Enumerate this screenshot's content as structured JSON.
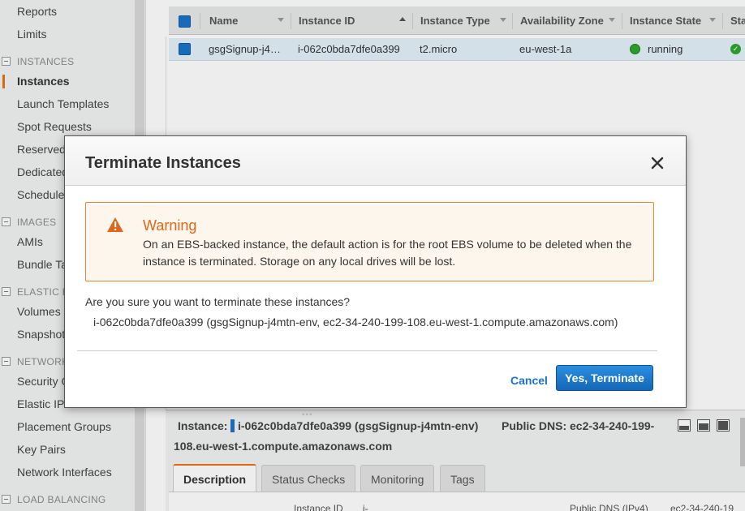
{
  "sidebar": {
    "items": [
      {
        "label": "Reports"
      },
      {
        "label": "Limits"
      },
      {
        "label": "Instances"
      },
      {
        "label": "Launch Templates"
      },
      {
        "label": "Spot Requests"
      },
      {
        "label": "Reserved"
      },
      {
        "label": "Dedicated"
      },
      {
        "label": "Schedule"
      },
      {
        "label": "AMIs"
      },
      {
        "label": "Bundle Ta"
      },
      {
        "label": "Volumes"
      },
      {
        "label": "Snapshot"
      },
      {
        "label": "Security G"
      },
      {
        "label": "Elastic IP"
      },
      {
        "label": "Placement Groups"
      },
      {
        "label": "Key Pairs"
      },
      {
        "label": "Network Interfaces"
      }
    ],
    "sections": [
      {
        "label": "INSTANCES"
      },
      {
        "label": "IMAGES"
      },
      {
        "label": "ELASTIC B"
      },
      {
        "label": "NETWORK"
      },
      {
        "label": "LOAD BALANCING"
      }
    ],
    "active_item": "Instances"
  },
  "table": {
    "columns": [
      "Name",
      "Instance ID",
      "Instance Type",
      "Availability Zone",
      "Instance State",
      "Sta"
    ],
    "rows": [
      {
        "name": "gsgSignup-j4…",
        "instance_id": "i-062c0bda7dfe0a399",
        "instance_type": "t2.micro",
        "availability_zone": "eu-west-1a",
        "instance_state": "running"
      }
    ]
  },
  "details": {
    "instance_label": "Instance:",
    "instance_value": "i-062c0bda7dfe0a399 (gsgSignup-j4mtn-env)",
    "public_dns_label": "Public DNS: ec2-34-240-199-",
    "public_dns_cont": "108.eu-west-1.compute.amazonaws.com",
    "drag_handle": "◦◦◦",
    "tabs": [
      {
        "label": "Description"
      },
      {
        "label": "Status Checks"
      },
      {
        "label": "Monitoring"
      },
      {
        "label": "Tags"
      }
    ],
    "kv": [
      {
        "text": "Instance ID"
      },
      {
        "text": "i-"
      },
      {
        "text": "Public DNS (IPv4)"
      },
      {
        "text": "ec2-34-240-19"
      }
    ]
  },
  "modal": {
    "title": "Terminate Instances",
    "close_icon": "close-icon",
    "warning": {
      "icon": "warning-icon",
      "title": "Warning",
      "text": "On an EBS-backed instance, the default action is for the root EBS volume to be deleted when the instance is terminated. Storage on any local drives will be lost."
    },
    "question": "Are you sure you want to terminate these instances?",
    "instance_line": "i-062c0bda7dfe0a399 (gsgSignup-j4mtn-env, ec2-34-240-199-108.eu-west-1.compute.amazonaws.com)",
    "cancel_label": "Cancel",
    "confirm_label": "Yes, Terminate"
  },
  "colors": {
    "accent": "#ec7211",
    "primary": "#1a73c9",
    "warning": "#e0661b",
    "running": "#2ea62e"
  }
}
